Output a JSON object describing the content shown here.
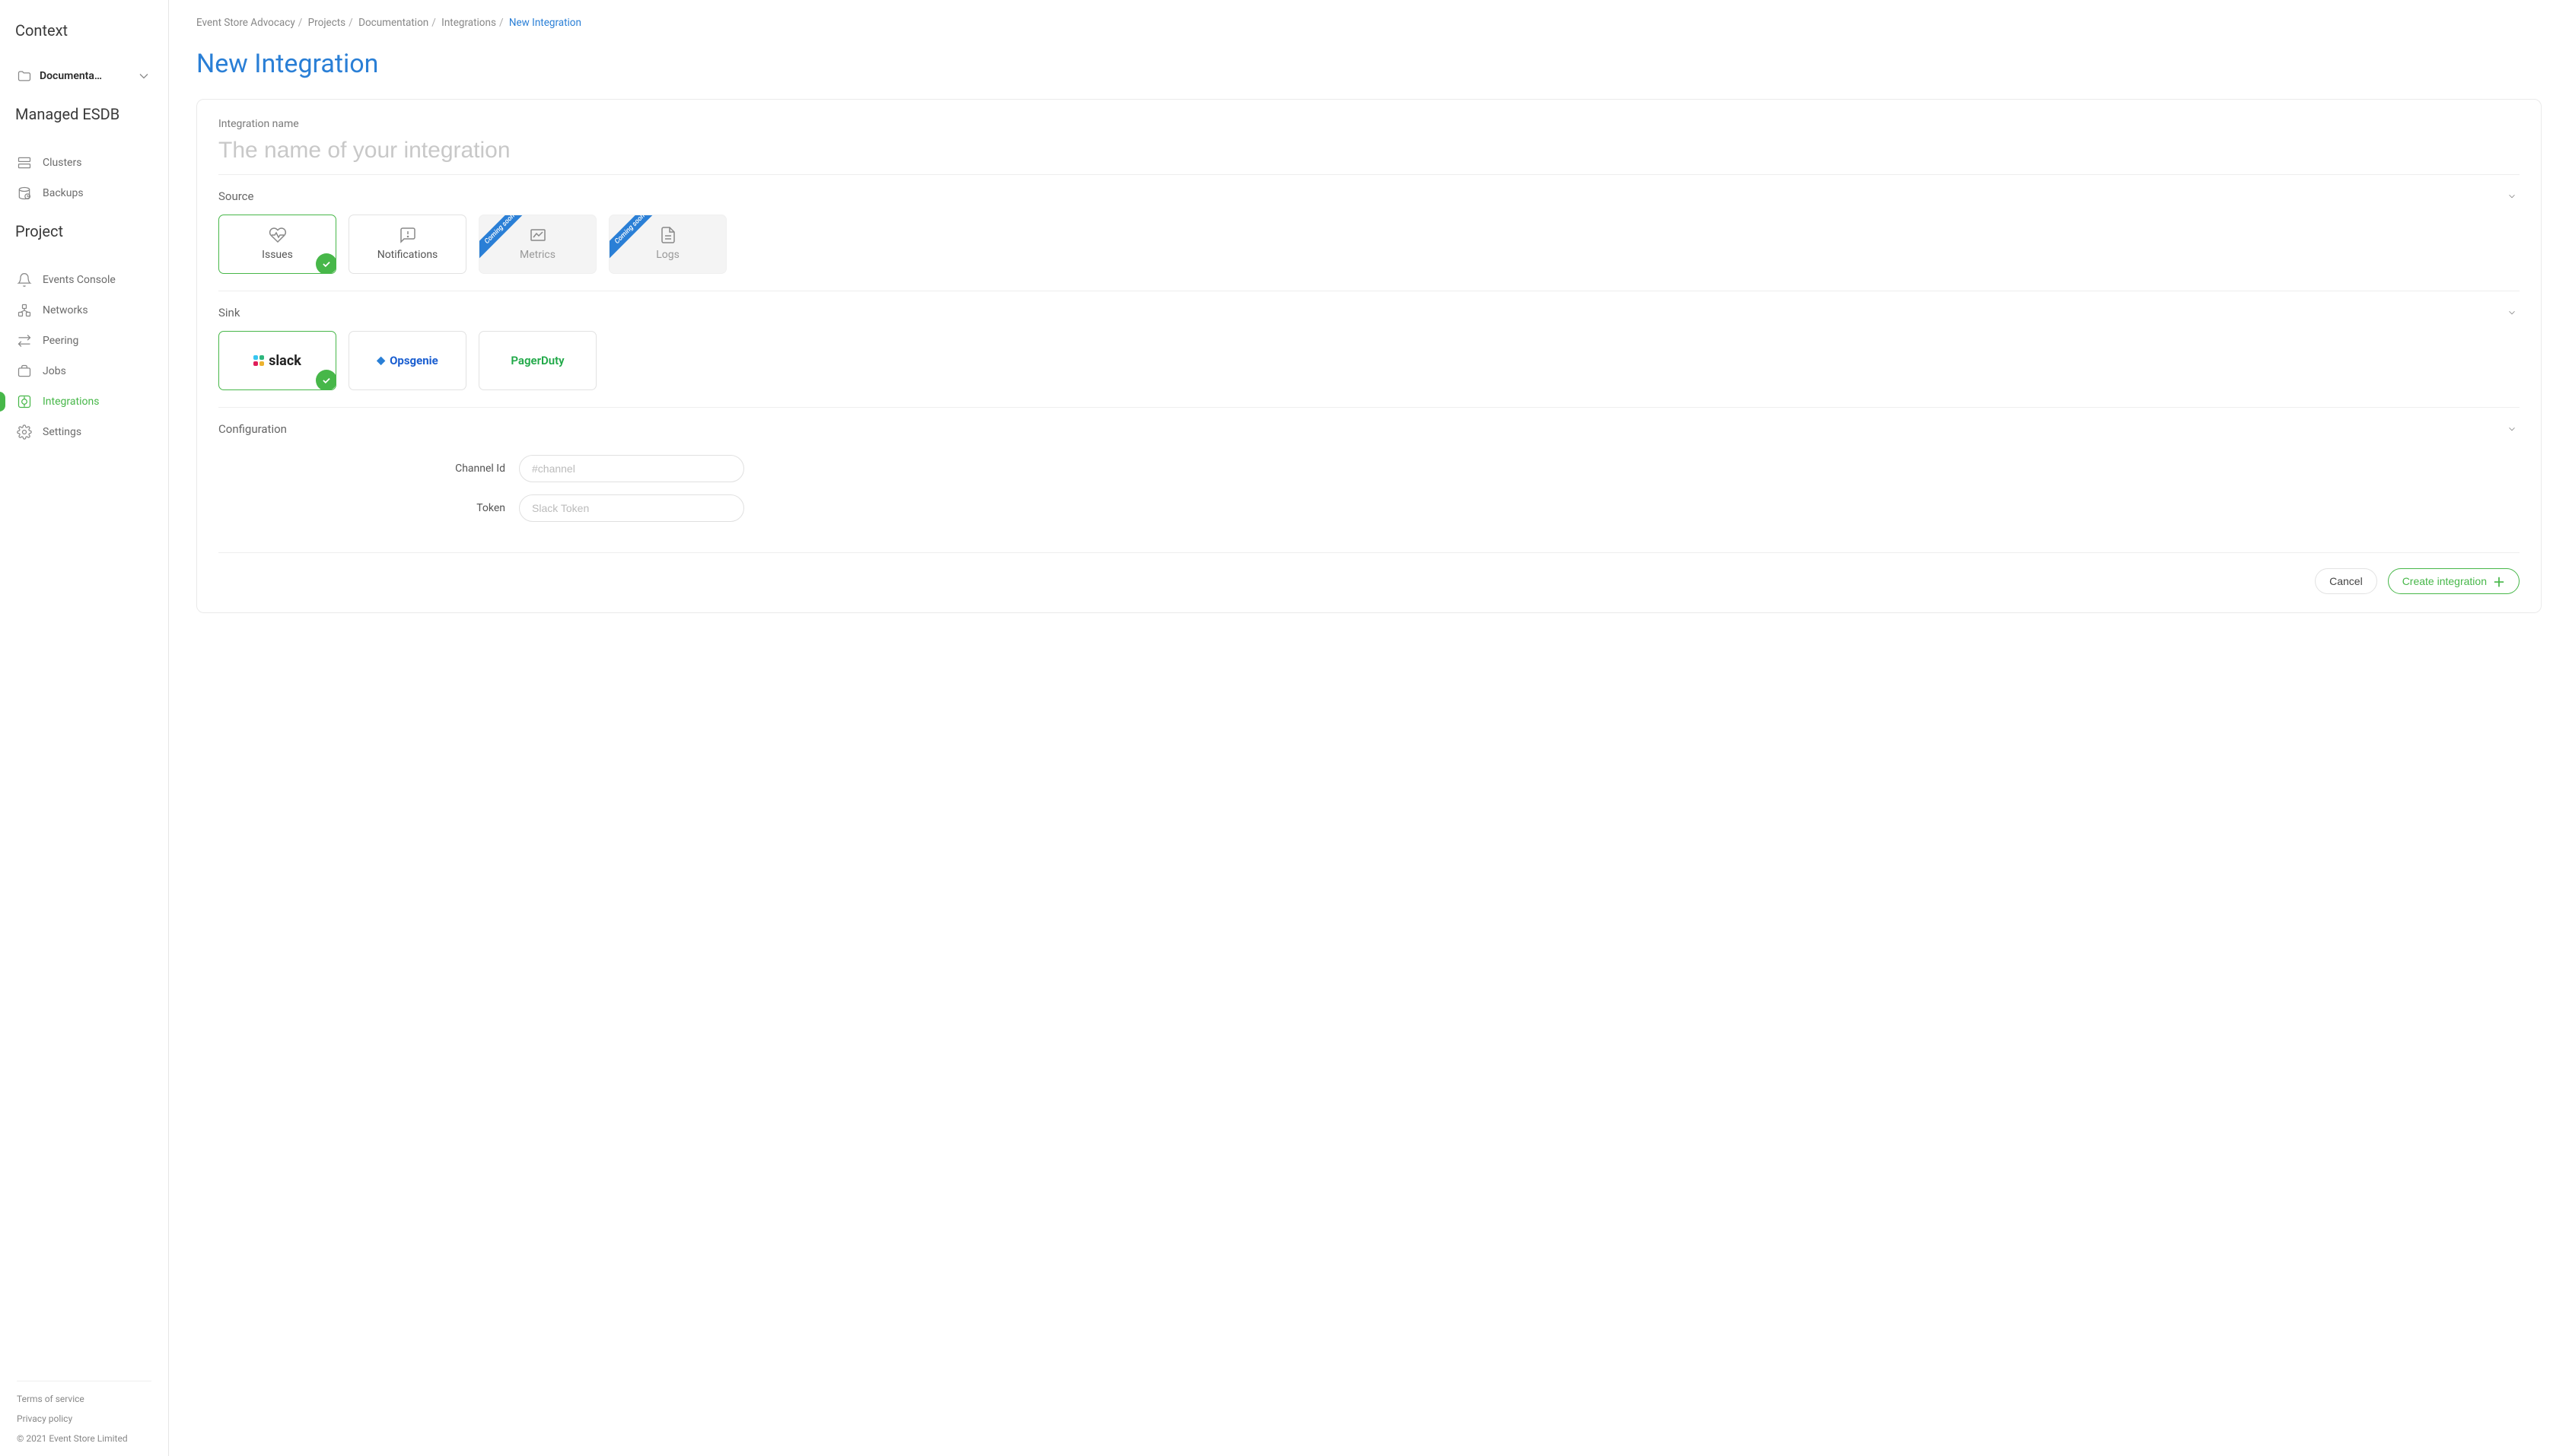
{
  "sidebar": {
    "context_heading": "Context",
    "context_item": "Documenta…",
    "managed_heading": "Managed ESDB",
    "project_heading": "Project",
    "nav_managed": [
      {
        "id": "clusters",
        "label": "Clusters"
      },
      {
        "id": "backups",
        "label": "Backups"
      }
    ],
    "nav_project": [
      {
        "id": "events-console",
        "label": "Events Console"
      },
      {
        "id": "networks",
        "label": "Networks"
      },
      {
        "id": "peering",
        "label": "Peering"
      },
      {
        "id": "jobs",
        "label": "Jobs"
      },
      {
        "id": "integrations",
        "label": "Integrations"
      },
      {
        "id": "settings",
        "label": "Settings"
      }
    ],
    "footer": {
      "terms": "Terms of service",
      "privacy": "Privacy policy",
      "copyright": "© 2021 Event Store Limited"
    }
  },
  "breadcrumb": {
    "items": [
      "Event Store Advocacy",
      "Projects",
      "Documentation",
      "Integrations"
    ],
    "current": "New Integration"
  },
  "page": {
    "title": "New Integration",
    "name_label": "Integration name",
    "name_placeholder": "The name of your integration",
    "source_label": "Source",
    "sink_label": "Sink",
    "config_label": "Configuration",
    "coming_soon": "Coming soon",
    "sources": [
      {
        "id": "issues",
        "label": "Issues",
        "selected": true,
        "disabled": false
      },
      {
        "id": "notifications",
        "label": "Notifications",
        "selected": false,
        "disabled": false
      },
      {
        "id": "metrics",
        "label": "Metrics",
        "selected": false,
        "disabled": true
      },
      {
        "id": "logs",
        "label": "Logs",
        "selected": false,
        "disabled": true
      }
    ],
    "sinks": [
      {
        "id": "slack",
        "label": "slack",
        "selected": true
      },
      {
        "id": "opsgenie",
        "label": "Opsgenie",
        "selected": false
      },
      {
        "id": "pagerduty",
        "label": "PagerDuty",
        "selected": false
      }
    ],
    "config": {
      "channel_label": "Channel Id",
      "channel_placeholder": "#channel",
      "token_label": "Token",
      "token_placeholder": "Slack Token"
    },
    "actions": {
      "cancel": "Cancel",
      "create": "Create integration"
    }
  }
}
